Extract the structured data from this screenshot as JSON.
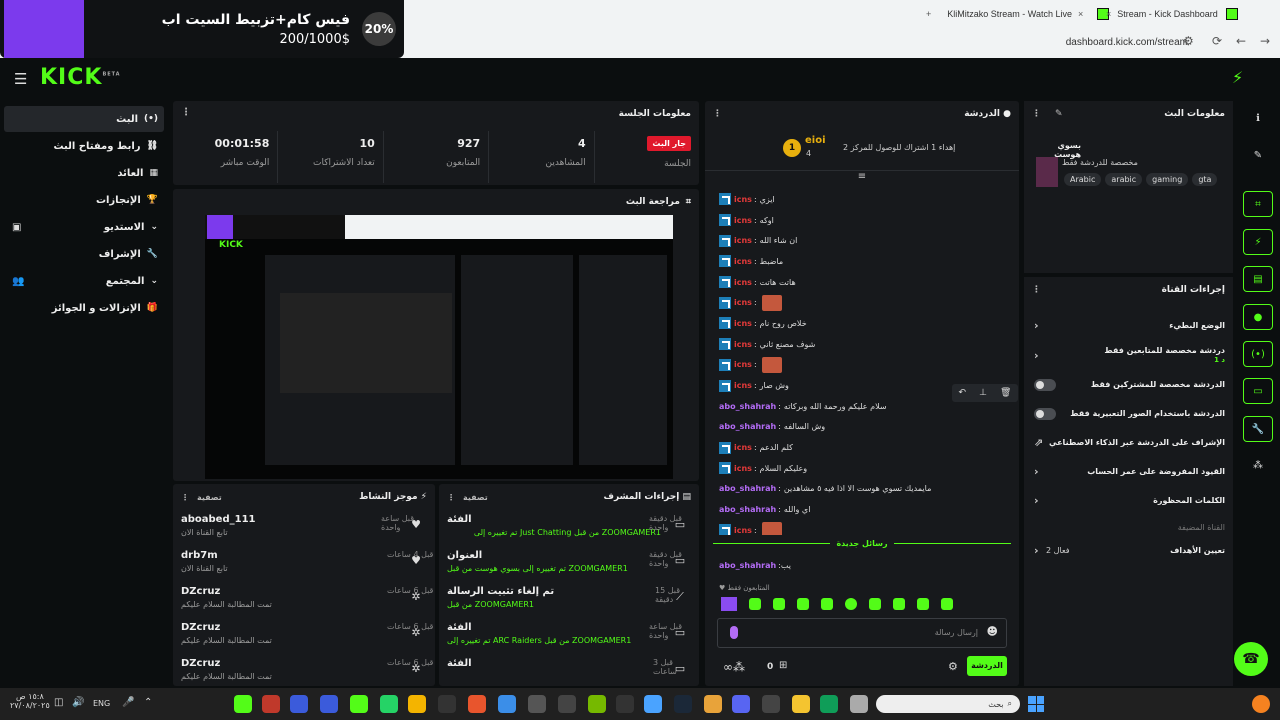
{
  "promo": {
    "title": "فيس كام+تزبيط السيت اب",
    "progress": "200/1000$",
    "percent": "20%"
  },
  "browser": {
    "tabs": [
      "KliMitzako Stream - Watch Live",
      "Stream - Kick Dashboard"
    ],
    "new_tab": "+",
    "close": "×",
    "url": "dashboard.kick.com/stream"
  },
  "header": {
    "logo": "KICK",
    "logo_sup": "BETA"
  },
  "nav": {
    "items": [
      {
        "label": "البث",
        "icon": "broadcast-icon"
      },
      {
        "label": "رابط ومفتاح البث",
        "icon": "link-icon"
      },
      {
        "label": "العائد",
        "icon": "revenue-icon"
      },
      {
        "label": "الإنجازات",
        "icon": "trophy-icon"
      },
      {
        "label": "الاستديو",
        "icon": "studio-icon"
      },
      {
        "label": "الإشراف",
        "icon": "wrench-icon"
      },
      {
        "label": "المجتمع",
        "icon": "community-icon"
      },
      {
        "label": "الإنزالات و الجوائز",
        "icon": "gift-icon"
      }
    ]
  },
  "session": {
    "title": "معلومات الجلسة",
    "badge": "جار البث",
    "stats": [
      {
        "label": "الجلسة",
        "value": ""
      },
      {
        "label": "المشاهدين",
        "value": "4"
      },
      {
        "label": "المتابعون",
        "value": "927"
      },
      {
        "label": "تعداد الاشتراكات",
        "value": "10"
      },
      {
        "label": "الوقت مباشر",
        "value": "00:01:58"
      }
    ]
  },
  "preview": {
    "title": "مراجعة البث",
    "mini_title": "فيس كام+تزبيط السيت اب",
    "mini_progress": "200/1000$",
    "mini_pct": "20%"
  },
  "activity": {
    "title": "موجز النشاط",
    "filter": "تصفية",
    "items": [
      {
        "name": "aboabed_111",
        "sub": "تابع القناة الان",
        "time": "قبل ساعة واحدة",
        "icon": "heart-icon"
      },
      {
        "name": "drb7m",
        "sub": "تابع القناة الان",
        "time": "قبل 4 ساعات",
        "icon": "heart-icon"
      },
      {
        "name": "DZcruz",
        "sub": "تمت المطالبة السلام عليكم",
        "time": "قبل 6 ساعات",
        "icon": "reward-icon"
      },
      {
        "name": "DZcruz",
        "sub": "تمت المطالبة السلام عليكم",
        "time": "قبل 6 ساعات",
        "icon": "reward-icon"
      },
      {
        "name": "DZcruz",
        "sub": "تمت المطالبة السلام عليكم",
        "time": "قبل 6 ساعات",
        "icon": "reward-icon"
      }
    ]
  },
  "modactions": {
    "title": "إجراءات المشرف",
    "filter": "تصفية",
    "items": [
      {
        "name": "الفئة",
        "sub": "تم تغييره إلى Just Chatting من قبل ZOOMGAMER1",
        "time": "قبل دقيقة واحدة",
        "icon": "category-icon"
      },
      {
        "name": "العنوان",
        "sub": "تم تغييره إلى بسوي هوست من قبل ZOOMGAMER1",
        "time": "قبل دقيقة واحدة",
        "icon": "title-icon"
      },
      {
        "name": "تم إلغاء تثبيت الرسالة",
        "sub": "من قبل ZOOMGAMER1",
        "time": "قبل 15 دقيقة",
        "icon": "unpin-icon"
      },
      {
        "name": "الفئة",
        "sub": "تم تغييره إلى ARC Raiders من قبل ZOOMGAMER1",
        "time": "قبل ساعة واحدة",
        "icon": "category-icon"
      },
      {
        "name": "الفئة",
        "sub": "",
        "time": "قبل 3 ساعات",
        "icon": "category-icon"
      }
    ]
  },
  "chat": {
    "title": "الدردشة",
    "goal_user": "eioi",
    "goal_count": "4",
    "goal_text": "إهداء 1 اشتراك للوصول للمركز 2",
    "goal_rank": "1",
    "new_messages": "رسائل جديدة",
    "followers_only": "المتابعون فقط",
    "placeholder": "إرسال رسالة",
    "send": "الدردشة",
    "viewers": "0",
    "messages": [
      {
        "user": "icns",
        "text": "ايزي",
        "kind": "red",
        "emote": false
      },
      {
        "user": "icns",
        "text": "اوكه",
        "kind": "red",
        "emote": false
      },
      {
        "user": "icns",
        "text": "ان شاء الله",
        "kind": "red",
        "emote": false
      },
      {
        "user": "icns",
        "text": "ماضبط",
        "kind": "red",
        "emote": false
      },
      {
        "user": "icns",
        "text": "هاتت هاتت",
        "kind": "red",
        "emote": false
      },
      {
        "user": "icns",
        "text": "",
        "kind": "red",
        "emote": true
      },
      {
        "user": "icns",
        "text": "خلاص روح نام",
        "kind": "red",
        "emote": false
      },
      {
        "user": "icns",
        "text": "شوف مصنع ثاني",
        "kind": "red",
        "emote": false
      },
      {
        "user": "icns",
        "text": "",
        "kind": "red",
        "emote": true
      },
      {
        "user": "icns",
        "text": "وش صار",
        "kind": "red",
        "emote": false
      },
      {
        "user": "abo_shahrah",
        "text": "سلام عليكم ورحمة الله وبركاته",
        "kind": "purple",
        "emote": false
      },
      {
        "user": "abo_shahrah",
        "text": "وش السالفه",
        "kind": "purple",
        "emote": false
      },
      {
        "user": "icns",
        "text": "كلم الدعم",
        "kind": "red",
        "emote": false
      },
      {
        "user": "icns",
        "text": "وعليكم السلام",
        "kind": "red",
        "emote": false
      },
      {
        "user": "abo_shahrah",
        "text": "مايمديك تسوي هوست الا اذا فيه ٥ مشاهدين",
        "kind": "purple",
        "emote": false
      },
      {
        "user": "abo_shahrah",
        "text": "اي والله",
        "kind": "purple",
        "emote": false
      },
      {
        "user": "icns",
        "text": "",
        "kind": "red",
        "emote": true
      }
    ],
    "after_new": {
      "user": "abo_shahrah",
      "text": "يب"
    }
  },
  "streaminfo": {
    "title": "معلومات البث",
    "stream_title": "بسوي هوست",
    "category": "مخصصة للدردشة فقط",
    "tags": [
      "Arabic",
      "arabic",
      "gaming",
      "gta"
    ]
  },
  "channel": {
    "title": "إجراءات القناة",
    "rows": [
      {
        "label": "الوضع البطيء",
        "control": "chevron"
      },
      {
        "label": "دردشة مخصصة للمتابعين فقط",
        "sub": "1 د",
        "control": "chevron"
      },
      {
        "label": "الدردشة مخصصة للمشتركين فقط",
        "control": "toggle"
      },
      {
        "label": "الدردشة باستخدام الصور التعبيرية فقط",
        "control": "toggle"
      },
      {
        "label": "الإشراف على الدردشة عبر الذكاء الاصطناعي",
        "control": "external"
      },
      {
        "label": "القيود المفروضة على عمر الحساب",
        "control": "chevron"
      },
      {
        "label": "الكلمات المحظورة",
        "control": "chevron"
      }
    ],
    "section": "القناة المضيفة",
    "goals": {
      "label": "تعيين الأهداف",
      "value": "فعال 2"
    }
  },
  "taskbar": {
    "search": "بحث",
    "lang": "ENG",
    "time": "١٥:٨ ص",
    "date": "٢٧/٠٨/٢٠٢٥"
  },
  "colors": {
    "accent": "#53fc18",
    "live": "#e0192c",
    "purple": "#7c3aed"
  }
}
